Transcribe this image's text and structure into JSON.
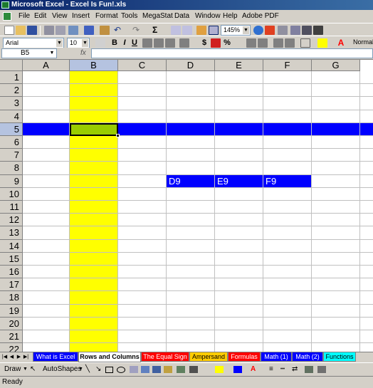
{
  "window": {
    "title": "Microsoft Excel - Excel Is Fun!.xls"
  },
  "menu": [
    "File",
    "Edit",
    "View",
    "Insert",
    "Format",
    "Tools",
    "MegaStat",
    "Data",
    "Window",
    "Help",
    "Adobe PDF"
  ],
  "toolbar": {
    "zoom": "145%",
    "font": "Arial",
    "size": "10",
    "bold_label": "B",
    "italic_label": "I",
    "underline_label": "U",
    "currency_label": "$",
    "percent_label": "%",
    "style": "Normal",
    "sum_label": "Σ"
  },
  "formula_bar": {
    "name_box": "B5",
    "fx": "fx",
    "formula": ""
  },
  "columns": [
    "A",
    "B",
    "C",
    "D",
    "E",
    "F",
    "G"
  ],
  "rows": [
    "1",
    "2",
    "3",
    "4",
    "5",
    "6",
    "7",
    "8",
    "9",
    "10",
    "11",
    "12",
    "13",
    "14",
    "15",
    "16",
    "17",
    "18",
    "19",
    "20",
    "21",
    "22"
  ],
  "cells": {
    "D9": "D9",
    "E9": "E9",
    "F9": "F9"
  },
  "tabs": [
    {
      "label": "What is Excel",
      "color": "#0000ff"
    },
    {
      "label": "Rows and Columns",
      "color": "#ffffff"
    },
    {
      "label": "The Equal Sign",
      "color": "#ff0000"
    },
    {
      "label": "Ampersand",
      "color": "#ffcc00"
    },
    {
      "label": "Formulas",
      "color": "#ff0000"
    },
    {
      "label": "Math (1)",
      "color": "#0000ff"
    },
    {
      "label": "Math (2)",
      "color": "#0000ff"
    },
    {
      "label": "Functions",
      "color": "#00ffff"
    }
  ],
  "draw_toolbar": {
    "draw": "Draw",
    "autoshapes": "AutoShapes"
  },
  "status": "Ready",
  "colors": {
    "column_b": "#ffff00",
    "row_5": "#0000ff",
    "active_cell": "#99cc00",
    "row_9_range": "#0000ff"
  }
}
